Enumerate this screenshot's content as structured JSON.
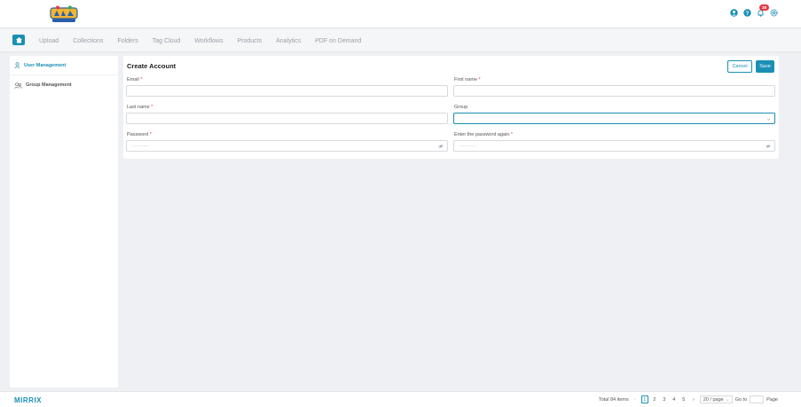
{
  "app": {
    "logo_alt": "Bambino",
    "notification_count": "38",
    "accent_color": "#1a8fb5"
  },
  "nav": {
    "items": [
      {
        "label": "Upload"
      },
      {
        "label": "Collections"
      },
      {
        "label": "Folders"
      },
      {
        "label": "Tag Cloud"
      },
      {
        "label": "Workflows"
      },
      {
        "label": "Products"
      },
      {
        "label": "Analytics"
      },
      {
        "label": "PDF on Demand"
      }
    ]
  },
  "sidebar": {
    "items": [
      {
        "label": "User Management",
        "icon": "user-icon",
        "active": true
      },
      {
        "label": "Group Management",
        "icon": "group-icon",
        "active": false
      }
    ]
  },
  "form": {
    "title": "Create Account",
    "cancel_label": "Cancel",
    "save_label": "Save",
    "email_label": "Email",
    "first_name_label": "First name",
    "last_name_label": "Last name",
    "group_label": "Group",
    "password_label": "Password",
    "password_again_label": "Enter the password again",
    "required_mark": "*",
    "password_mask": "············",
    "password_again_mask": "············"
  },
  "footer": {
    "brand": "MIRRIX",
    "total": "Total 84 items",
    "prev": "‹",
    "pages": [
      "1",
      "2",
      "3",
      "4",
      "5"
    ],
    "next": "›",
    "page_size": "20 / page",
    "go_to": "Go to",
    "page_word": "Page"
  }
}
